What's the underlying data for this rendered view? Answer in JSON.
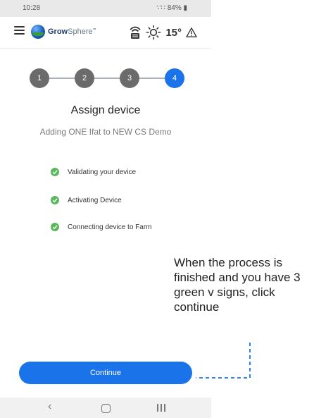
{
  "status_bar": {
    "time": "10:28",
    "indicators": "84%"
  },
  "header": {
    "brand_bold": "Grow",
    "brand_light": "Sphere",
    "brand_mark": "™",
    "weather_value": "15°",
    "icons": [
      "menu-icon",
      "sync-icon",
      "sun-icon",
      "alert-icon"
    ]
  },
  "stepper": {
    "steps": [
      "1",
      "2",
      "3",
      "4"
    ],
    "current": 4
  },
  "page": {
    "title": "Assign device",
    "subtitle": "Adding ONE Ifat to NEW CS Demo"
  },
  "checklist": [
    {
      "label": "Validating your device",
      "status": "done"
    },
    {
      "label": "Activating Device",
      "status": "done"
    },
    {
      "label": "Connecting device to Farm",
      "status": "done"
    }
  ],
  "continue_label": "Continue",
  "annotation": {
    "text": "When the process is finished and you have 3 green v signs, click continue"
  },
  "colors": {
    "accent": "#1a73e8",
    "step_inactive": "#6b6b6b",
    "check": "#5cb85c",
    "annotation_line": "#1a73e8"
  }
}
